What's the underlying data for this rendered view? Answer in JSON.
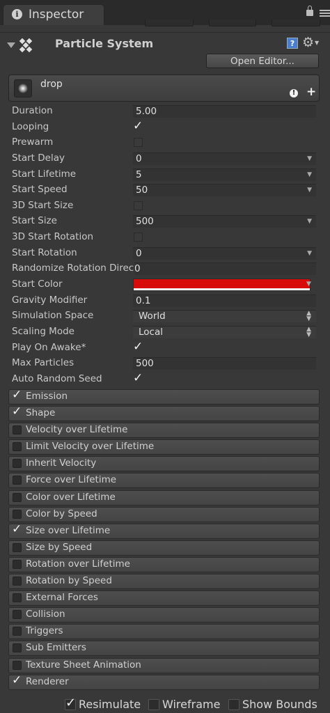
{
  "window": {
    "tab_title": "Inspector"
  },
  "component": {
    "title": "Particle System",
    "open_editor_label": "Open Editor...",
    "help_icon_glyph": "?",
    "gear_icon_glyph": "⚙"
  },
  "subsystem": {
    "name": "drop",
    "warning_glyph": "!",
    "add_glyph": "+"
  },
  "properties": {
    "duration": {
      "label": "Duration",
      "value": "5.00"
    },
    "looping": {
      "label": "Looping",
      "checked": true
    },
    "prewarm": {
      "label": "Prewarm",
      "checked": false
    },
    "start_delay": {
      "label": "Start Delay",
      "value": "0"
    },
    "start_lifetime": {
      "label": "Start Lifetime",
      "value": "5"
    },
    "start_speed": {
      "label": "Start Speed",
      "value": "50"
    },
    "start_size_3d": {
      "label": "3D Start Size",
      "checked": false
    },
    "start_size": {
      "label": "Start Size",
      "value": "500"
    },
    "start_rotation_3d": {
      "label": "3D Start Rotation",
      "checked": false
    },
    "start_rotation": {
      "label": "Start Rotation",
      "value": "0"
    },
    "randomize_rotation": {
      "label": "Randomize Rotation Direc",
      "value": "0"
    },
    "start_color": {
      "label": "Start Color",
      "color": "#d80b0b"
    },
    "gravity_modifier": {
      "label": "Gravity Modifier",
      "value": "0.1"
    },
    "simulation_space": {
      "label": "Simulation Space",
      "value": "World"
    },
    "scaling_mode": {
      "label": "Scaling Mode",
      "value": "Local"
    },
    "play_on_awake": {
      "label": "Play On Awake*",
      "checked": true
    },
    "max_particles": {
      "label": "Max Particles",
      "value": "500"
    },
    "auto_random_seed": {
      "label": "Auto Random Seed",
      "checked": true
    }
  },
  "modules": [
    {
      "label": "Emission",
      "enabled": true
    },
    {
      "label": "Shape",
      "enabled": true
    },
    {
      "label": "Velocity over Lifetime",
      "enabled": false
    },
    {
      "label": "Limit Velocity over Lifetime",
      "enabled": false
    },
    {
      "label": "Inherit Velocity",
      "enabled": false
    },
    {
      "label": "Force over Lifetime",
      "enabled": false
    },
    {
      "label": "Color over Lifetime",
      "enabled": false
    },
    {
      "label": "Color by Speed",
      "enabled": false
    },
    {
      "label": "Size over Lifetime",
      "enabled": true
    },
    {
      "label": "Size by Speed",
      "enabled": false
    },
    {
      "label": "Rotation over Lifetime",
      "enabled": false
    },
    {
      "label": "Rotation by Speed",
      "enabled": false
    },
    {
      "label": "External Forces",
      "enabled": false
    },
    {
      "label": "Collision",
      "enabled": false
    },
    {
      "label": "Triggers",
      "enabled": false
    },
    {
      "label": "Sub Emitters",
      "enabled": false
    },
    {
      "label": "Texture Sheet Animation",
      "enabled": false
    },
    {
      "label": "Renderer",
      "enabled": true
    }
  ],
  "bottom": {
    "resimulate": {
      "label": "Resimulate",
      "checked": true
    },
    "wireframe": {
      "label": "Wireframe",
      "checked": false
    },
    "show_bounds": {
      "label": "Show Bounds",
      "checked": false
    }
  }
}
